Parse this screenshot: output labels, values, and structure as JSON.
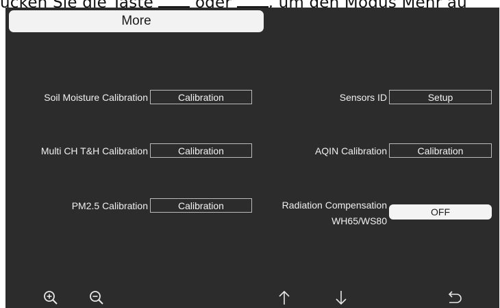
{
  "document": {
    "partial_line_1": "ücken Sie die Taste",
    "partial_line_2": "oder",
    "partial_line_3": ", um den Modus Mehr au"
  },
  "screen": {
    "title": "More",
    "left_items": [
      {
        "label": "Soil Moisture Calibration",
        "button": "Calibration"
      },
      {
        "label": "Multi CH T&H Calibration",
        "button": "Calibration"
      },
      {
        "label": "PM2.5 Calibration",
        "button": "Calibration"
      }
    ],
    "right_items": [
      {
        "label": "Sensors ID",
        "button": "Setup"
      },
      {
        "label": "AQIN Calibration",
        "button": "Calibration"
      },
      {
        "label_line1": "Radiation Compensation",
        "label_line2": "WH65/WS80",
        "toggle": "OFF"
      }
    ],
    "toolbar": [
      {
        "icon": "zoom-in-icon"
      },
      {
        "icon": "zoom-out-icon"
      },
      {
        "icon": "arrow-up-icon"
      },
      {
        "icon": "arrow-down-icon"
      },
      {
        "icon": "back-icon"
      }
    ]
  },
  "colors": {
    "screen_background": "#2c2c2c",
    "title_bar": "#f2f2f2",
    "text": "#f0f0f0",
    "button_border": "#bdbdbd"
  }
}
